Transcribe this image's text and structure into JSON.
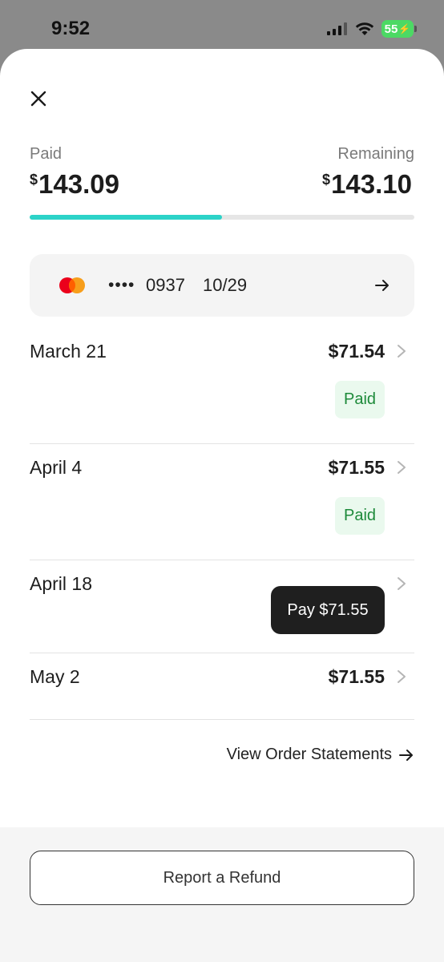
{
  "status_bar": {
    "time": "9:52",
    "battery": "55",
    "icons": [
      "cellular-signal-icon",
      "wifi-icon",
      "battery-charging-icon"
    ]
  },
  "header": {
    "close_icon": "close-icon"
  },
  "summary": {
    "paid_label": "Paid",
    "paid_currency": "$",
    "paid_amount": "143.09",
    "remaining_label": "Remaining",
    "remaining_currency": "$",
    "remaining_amount": "143.10",
    "progress_fraction": 0.5,
    "progress_color": "#2cd3c8"
  },
  "payment_card": {
    "brand_icon": "mastercard-icon",
    "masked": "••••",
    "last4": "0937",
    "expiry": "10/29",
    "arrow_icon": "arrow-right-icon"
  },
  "installments": [
    {
      "date": "March 21",
      "amount": "$71.54",
      "status": "Paid"
    },
    {
      "date": "April 4",
      "amount": "$71.55",
      "status": "Paid"
    },
    {
      "date": "April 18",
      "action": "Pay $71.55"
    },
    {
      "date": "May 2",
      "amount": "$71.55"
    }
  ],
  "links": {
    "view_statements": "View Order Statements"
  },
  "footer": {
    "refund_label": "Report a Refund"
  },
  "colors": {
    "accent": "#2cd3c8",
    "paid_badge_bg": "#eaf9ee",
    "paid_badge_text": "#1d8a3a",
    "pay_button_bg": "#1f1f1f"
  }
}
